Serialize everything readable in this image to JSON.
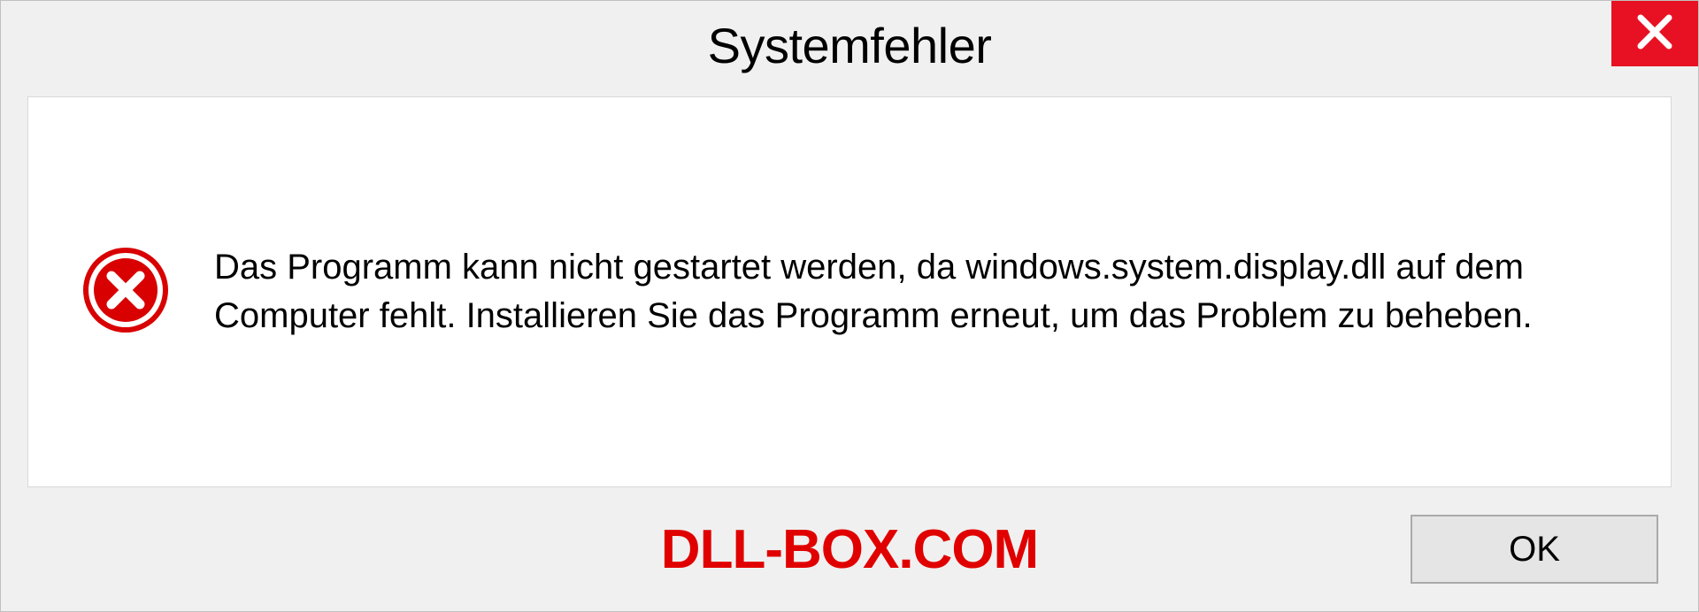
{
  "dialog": {
    "title": "Systemfehler",
    "message": "Das Programm kann nicht gestartet werden, da windows.system.display.dll auf dem Computer fehlt. Installieren Sie das Programm erneut, um das Problem zu beheben.",
    "ok_label": "OK"
  },
  "watermark": "DLL-BOX.COM",
  "colors": {
    "close_bg": "#e81123",
    "error_red": "#d80000",
    "watermark_red": "#e00000"
  }
}
